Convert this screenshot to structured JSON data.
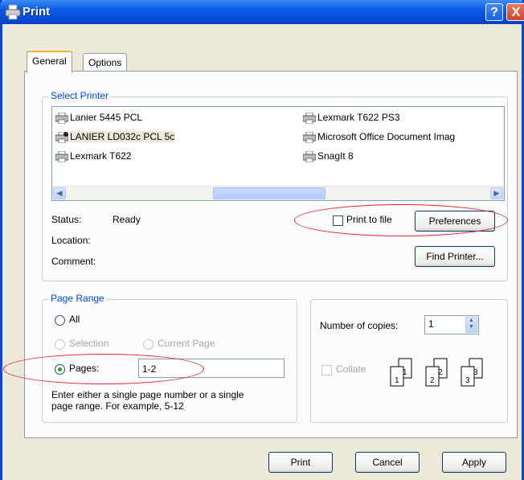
{
  "window": {
    "title": "Print",
    "help_glyph": "?",
    "close_glyph": "X"
  },
  "tabs": [
    {
      "label": "General"
    },
    {
      "label": "Options"
    }
  ],
  "select_printer": {
    "group_label": "Select Printer",
    "printers": [
      {
        "name": "Lanier 5445 PCL",
        "selected": false
      },
      {
        "name": "LANIER LD032c PCL 5c",
        "selected": true
      },
      {
        "name": "Lexmark T622",
        "selected": false
      },
      {
        "name": "Lexmark T622 PS3",
        "selected": false
      },
      {
        "name": "Microsoft Office Document Imag",
        "selected": false
      },
      {
        "name": "SnagIt 8",
        "selected": false
      }
    ],
    "status_label": "Status:",
    "status_value": "Ready",
    "location_label": "Location:",
    "comment_label": "Comment:",
    "print_to_file_label": "Print to file",
    "print_to_file_checked": false,
    "preferences_button": "Preferences",
    "find_printer_button": "Find Printer..."
  },
  "page_range": {
    "group_label": "Page Range",
    "all_label": "All",
    "selection_label": "Selection",
    "current_page_label": "Current Page",
    "pages_label": "Pages:",
    "pages_value": "1-2",
    "selected_option": "Pages",
    "help_text_line1": "Enter either a single page number or a single",
    "help_text_line2": "page range.  For example, 5-12"
  },
  "copies": {
    "number_label": "Number of copies:",
    "number_value": "1",
    "collate_label": "Collate",
    "collate_checked": false,
    "collate_pages": [
      "1",
      "1",
      "2",
      "2",
      "3",
      "3"
    ]
  },
  "buttons": {
    "print": "Print",
    "cancel": "Cancel",
    "apply": "Apply"
  },
  "annotations": {
    "highlight_color": "#e0202a"
  },
  "colors": {
    "title_bar": "#0a5ae8",
    "group_label": "#0046d5",
    "dialog_bg": "#ece9d8"
  }
}
